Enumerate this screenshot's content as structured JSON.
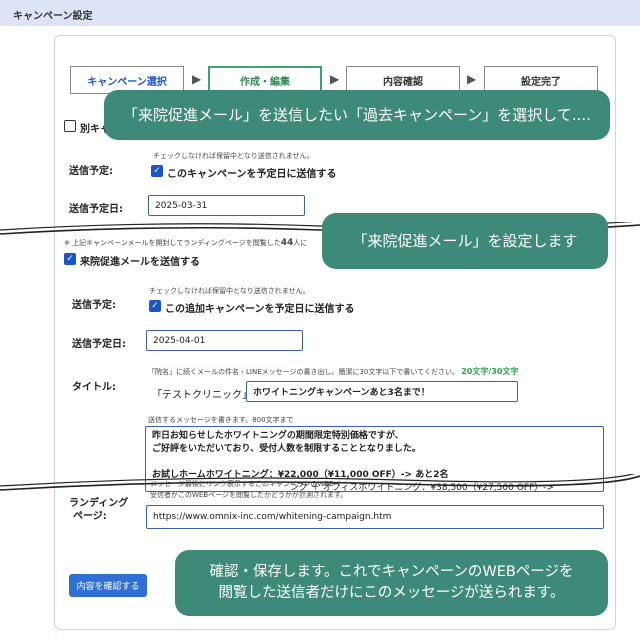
{
  "header": {
    "title": "キャンペーン設定"
  },
  "steps": [
    {
      "label": "キャンペーン選択"
    },
    {
      "label": "作成・編集"
    },
    {
      "label": "内容確認"
    },
    {
      "label": "設定完了"
    }
  ],
  "arrow_glyph": "▶",
  "top_section": {
    "other_checkbox_label": "別キャ",
    "send_plan_label": "送信予定:",
    "send_plan_hint": "チェックしなければ保留中となり送信されません。",
    "send_plan_checkbox": "このキャンペーンを予定日に送信する",
    "send_date_label": "送信予定日:",
    "send_date_value": "2025-03-31"
  },
  "mid_note": {
    "text_prefix": "※ 上記キャンペーンメールを開封してランディングページを閲覧した",
    "count": "44",
    "text_suffix": "人に"
  },
  "visit_mail": {
    "checkbox_label": "来院促進メールを送信する",
    "send_plan_label": "送信予定:",
    "send_plan_hint": "チェックしなければ保留中となり送信されません。",
    "send_plan_checkbox": "この追加キャンペーンを予定日に送信する",
    "send_date_label": "送信予定日:",
    "send_date_value": "2025-04-01",
    "title_label": "タイトル:",
    "title_hint": "「院名」に続くメールの件名・LINEメッセージの書き出し。簡潔に30文字以下で書いてください。",
    "title_counter": "20文字/30文字",
    "title_prefix": "「テストクリニック」",
    "title_value": "ホワイトニングキャンペーンあと3名まで！",
    "message_hint": "送信するメッセージを書きます。800文字まで",
    "message_lines": [
      "昨日お知らせしたホワイトニングの期間限定特別価格ですが、",
      "ご好評をいただいており、受付人数を制限することとなりました。",
      "",
      "お試しホームホワイトニング：¥22,000（¥11,000 OFF）-> あと2名",
      "　　　　　　　　　　　　　　　 ング ＋ オフィスホワイトニング：¥38,500（¥27,500 OFF）->"
    ],
    "landing_hint_1": "メッセージ最後にリンク表示するこのキャンペーンのWEBペ",
    "landing_hint_2": "受信者がこのWEBページを閲覧したかどうかが計測されます。",
    "landing_label_1": "ランディング",
    "landing_label_2": "ページ:",
    "landing_url": "https://www.omnix-inc.com/whitening-campaign.htm"
  },
  "confirm_button": "内容を確認する",
  "callouts": {
    "c1": "「来院促進メール」を送信したい「過去キャンペーン」を選択して....",
    "c2": "「来院促進メール」を設定します",
    "c3_line1": "確認・保存します。これでキャンペーンのWEBページを",
    "c3_line2": "閲覧した送信者だけにこのメッセージが送られます。"
  },
  "colors": {
    "callout_bg": "#3d8a78",
    "accent_blue": "#1a56c9",
    "active_step": "#3aa56b"
  }
}
